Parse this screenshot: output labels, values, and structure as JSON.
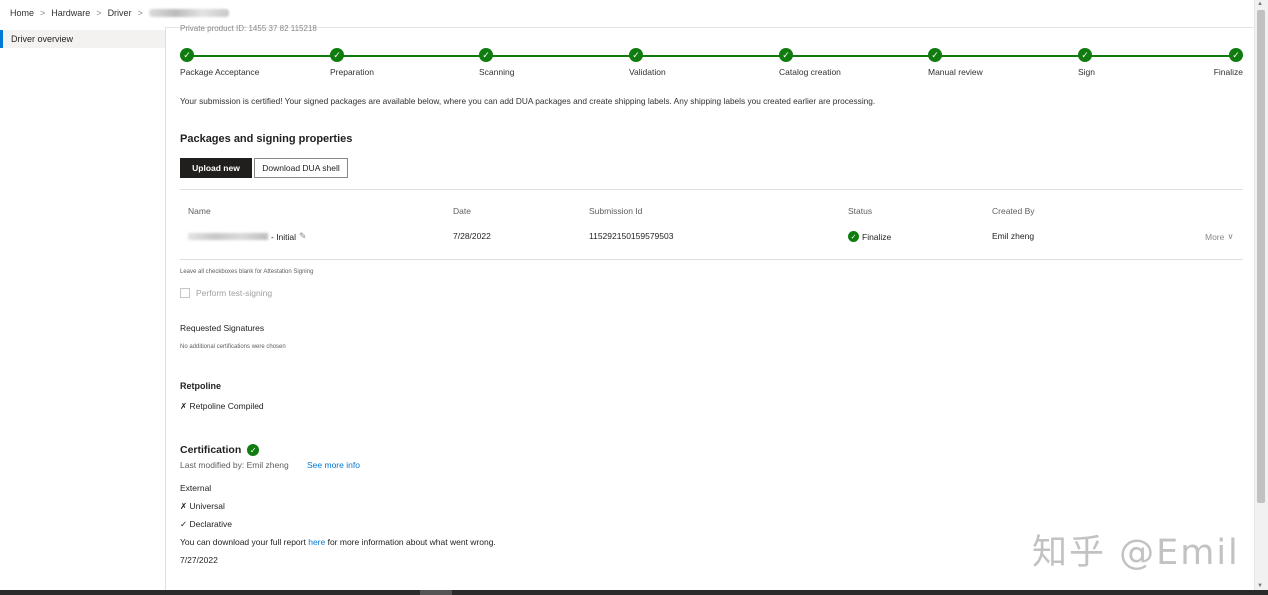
{
  "breadcrumb": {
    "items": [
      "Home",
      "Hardware",
      "Driver"
    ],
    "separator": ">"
  },
  "sidebar": {
    "items": [
      {
        "label": "Driver overview",
        "selected": true
      }
    ]
  },
  "main": {
    "private_product_id": "Private product ID: 1455 37 82 115218",
    "stepper": {
      "steps": [
        "Package Acceptance",
        "Preparation",
        "Scanning",
        "Validation",
        "Catalog creation",
        "Manual review",
        "Sign",
        "Finalize"
      ],
      "check_glyph": "✓"
    },
    "cert_message": "Your submission is certified! Your signed packages are available below, where you can add DUA packages and create shipping labels. Any shipping labels you created earlier are processing.",
    "packages_title": "Packages and signing properties",
    "upload_label": "Upload new",
    "download_label": "Download DUA shell",
    "table": {
      "headers": [
        "Name",
        "Date",
        "Submission Id",
        "Status",
        "Created By"
      ],
      "row": {
        "name_suffix": "- Initial",
        "date": "7/28/2022",
        "submission_id": "115292150159579503",
        "status": "Finalize",
        "created_by": "Emil zheng",
        "more": "More"
      }
    },
    "attestation_note": "Leave all checkboxes blank for Attestation Signing",
    "test_signing_label": "Perform test-signing",
    "requested_signatures_label": "Requested Signatures",
    "no_certs_note": "No additional certifications were chosen",
    "retpoline_title": "Retpoline",
    "retpoline_item": "✗ Retpoline Compiled",
    "certification": {
      "title": "Certification",
      "last_modified": "Last modified by: Emil zheng",
      "see_more": "See more info",
      "external": "External",
      "universal": "✗ Universal",
      "declarative": "✓ Declarative",
      "report_prefix": "You can download your full report ",
      "report_link": "here",
      "report_suffix": " for more information about what went wrong.",
      "date": "7/27/2022"
    }
  },
  "watermark": "知乎 @Emil",
  "colors": {
    "accent": "#0078d4",
    "success": "#107c10",
    "primary_button": "#201f1e"
  }
}
